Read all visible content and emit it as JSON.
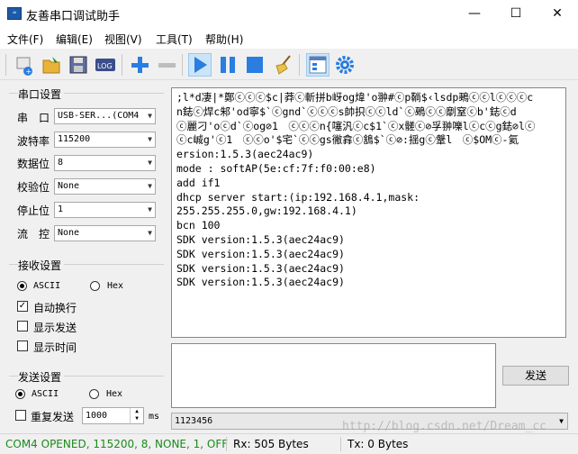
{
  "window": {
    "title": "友善串口调试助手",
    "minimize": "—",
    "maximize": "☐",
    "close": "✕"
  },
  "menu": [
    "文件(F)",
    "编辑(E)",
    "视图(V)",
    "工具(T)",
    "帮助(H)"
  ],
  "toolbar": {
    "log_label": "LOG",
    "buttons": [
      "new-connection-icon",
      "open-folder-icon",
      "save-icon",
      "log-icon",
      "add-icon",
      "remove-icon",
      "play-icon",
      "pause-icon",
      "stop-icon",
      "clear-broom-icon",
      "window-layout-icon",
      "settings-gear-icon"
    ]
  },
  "serial_settings": {
    "title": "串口设置",
    "port_label": "串　口",
    "port_value": "USB-SER...(COM4",
    "baud_label": "波特率",
    "baud_value": "115200",
    "databits_label": "数据位",
    "databits_value": "8",
    "parity_label": "校验位",
    "parity_value": "None",
    "stopbits_label": "停止位",
    "stopbits_value": "1",
    "flow_label": "流　控",
    "flow_value": "None"
  },
  "receive_settings": {
    "title": "接收设置",
    "ascii_label": "ASCII",
    "hex_label": "Hex",
    "mode": "ASCII",
    "autowrap_label": "自动换行",
    "autowrap_checked": true,
    "show_send_label": "显示发送",
    "show_send_checked": false,
    "show_time_label": "显示时间",
    "show_time_checked": false
  },
  "send_settings": {
    "title": "发送设置",
    "ascii_label": "ASCII",
    "hex_label": "Hex",
    "mode": "ASCII",
    "repeat_label": "重复发送",
    "repeat_checked": false,
    "interval_value": "1000",
    "interval_unit": "ms"
  },
  "receive_area": {
    "lines": [
      ";l*d凄|*鄭ⓒⓒⓒ$c|莽ⓒ斬拼b岈og煒'o翀#ⓒp鞝$‹lsdp鵐ⓒⓒlⓒⓒⓒc",
      "n鋕ⓒ焊c邾'od寧$`ⓒgnd`ⓒⓒⓒs帥抧ⓒⓒld`ⓒ鵐ⓒⓒ劘窒ⓒb'鋕ⓒd",
      "ⓒ麗刁'oⓒd`ⓒog⊘1　ⓒⓒⓒn{噻汎ⓒc$1`ⓒx髊ⓒ⊘孚翀嚛lⓒcⓒg鋕⊘lⓒ",
      "ⓒc峸g'ⓒ1　ⓒⓒo'$宅`ⓒⓒgs徶搻ⓒ鵨$`ⓒ⊘:揺gⓒ鞶l　ⓒ$OMⓒ-氦",
      "ersion:1.5.3(aec24ac9)",
      "mode : softAP(5e:cf:7f:f0:00:e8)",
      "add if1",
      "dhcp server start:(ip:192.168.4.1,mask:",
      "255.255.255.0,gw:192.168.4.1)",
      "bcn 100",
      "SDK version:1.5.3(aec24ac9)",
      "SDK version:1.5.3(aec24ac9)",
      "SDK version:1.5.3(aec24ac9)",
      "SDK version:1.5.3(aec24ac9)"
    ]
  },
  "send_area": {
    "text": "",
    "send_button": "发送",
    "history_value": "1123456"
  },
  "status": {
    "port_status": "COM4 OPENED, 115200, 8, NONE, 1, OFF",
    "rx": "Rx: 505 Bytes",
    "tx": "Tx: 0 Bytes",
    "status_color": "#1a8a1a"
  },
  "watermark": "http://blog.csdn.net/Dream_cc"
}
